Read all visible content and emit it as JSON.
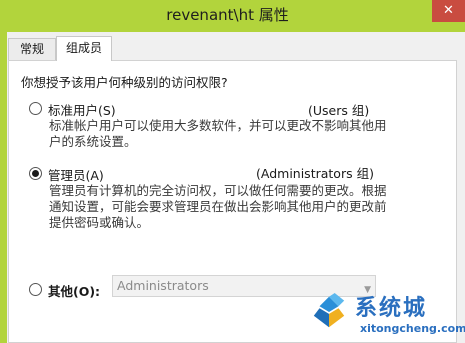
{
  "window": {
    "title": "revenant\\ht 属性",
    "close_glyph": "✕"
  },
  "tabs": [
    {
      "label": "常规",
      "active": false
    },
    {
      "label": "组成员",
      "active": true
    }
  ],
  "prompt": "你想授予该用户何种级别的访问权限?",
  "options": {
    "standard": {
      "label": "标准用户(S)",
      "group": "(Users 组)",
      "selected": false,
      "description_lines": [
        "标准帐户用户可以使用大多数软件，并可以更改不影响其他用",
        "户的系统设置。"
      ]
    },
    "admin": {
      "label": "管理员(A)",
      "group": "(Administrators 组)",
      "selected": true,
      "description_lines": [
        "管理员有计算机的完全访问权，可以做任何需要的更改。根据",
        "通知设置，可能会要求管理员在做出会影响其他用户的更改前",
        "提供密码或确认。"
      ]
    },
    "other": {
      "label": "其他(O):",
      "selected": false,
      "combo_value": "Administrators"
    }
  },
  "watermark": {
    "title": "系统城",
    "url": "xitongcheng.com"
  },
  "colors": {
    "accent_frame": "#b2d43c",
    "close_button": "#c94c40",
    "watermark": "#2a6fbf"
  }
}
